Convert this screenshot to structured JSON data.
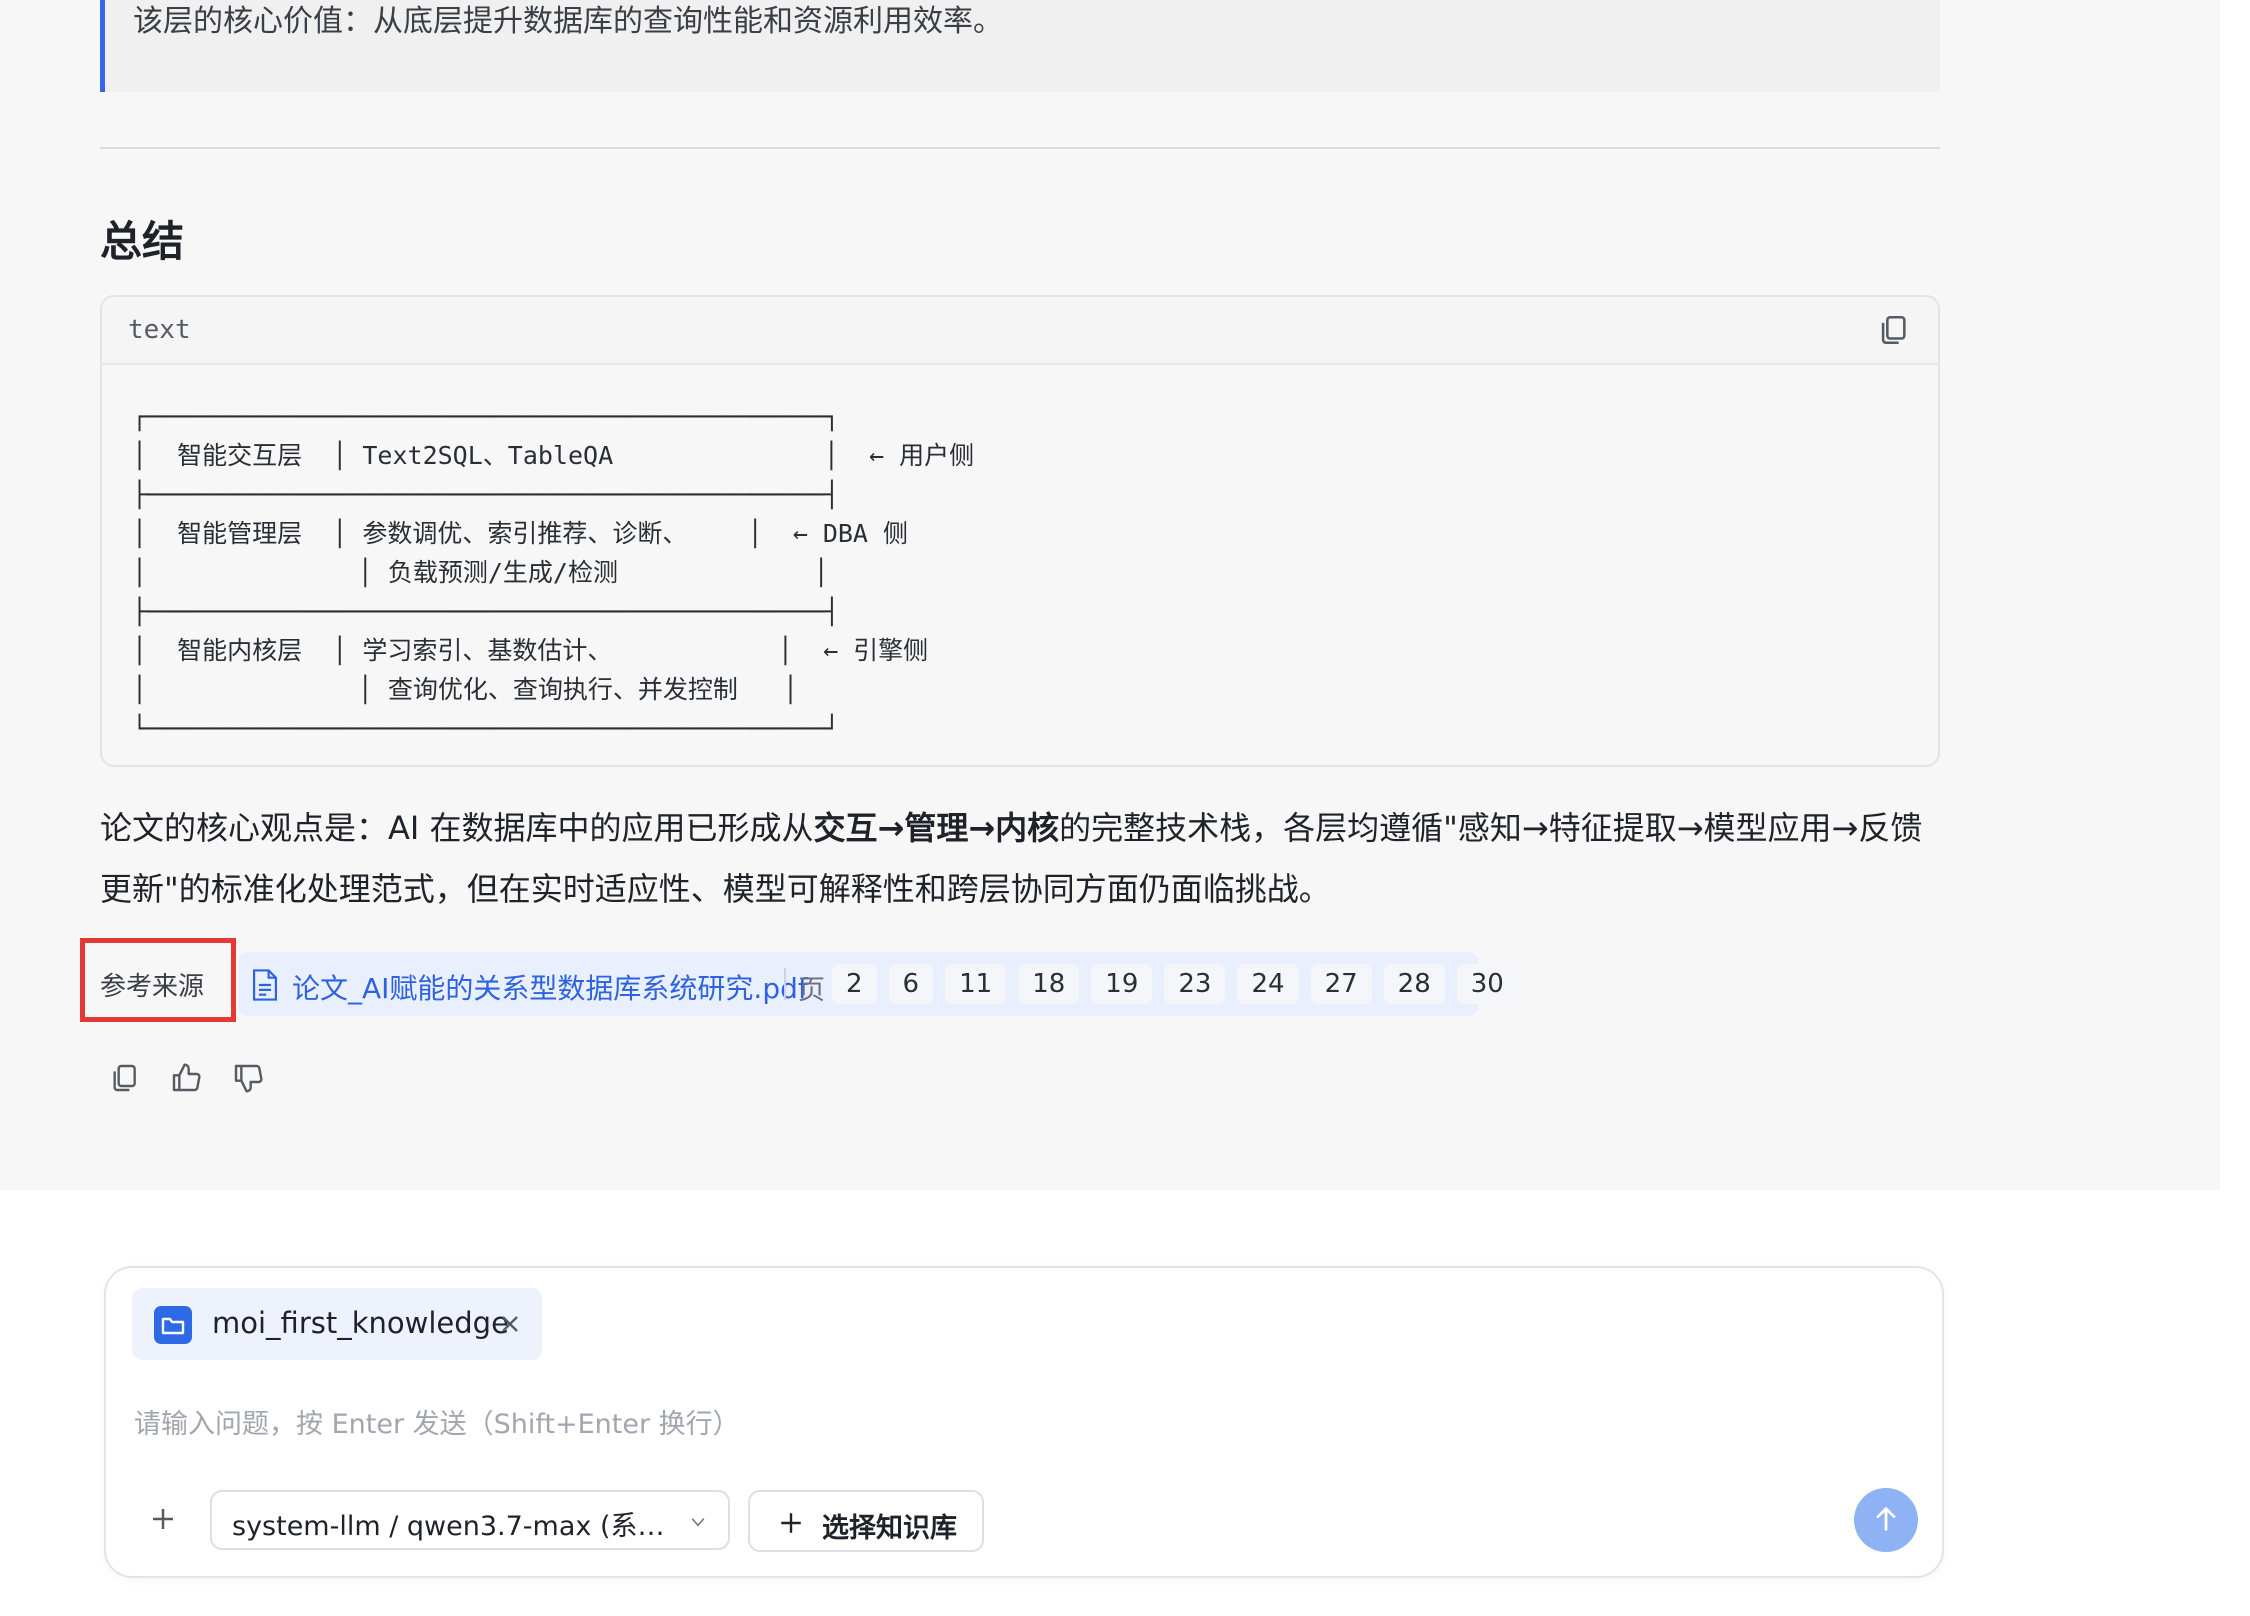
{
  "quote": {
    "text": "该层的核心价值：从底层提升数据库的查询性能和资源利用效率。"
  },
  "summary": {
    "title": "总结"
  },
  "code_block": {
    "language": "text",
    "content": "┌─────────────────────────────────────────────┐\n│  智能交互层  │ Text2SQL、TableQA              │  ← 用户侧\n├─────────────────────────────────────────────┤\n│  智能管理层  │ 参数调优、索引推荐、诊断、    │  ← DBA 侧\n│              │ 负载预测/生成/检测             │\n├─────────────────────────────────────────────┤\n│  智能内核层  │ 学习索引、基数估计、           │  ← 引擎侧\n│              │ 查询优化、查询执行、并发控制   │\n└─────────────────────────────────────────────┘"
  },
  "conclusion": {
    "prefix": "论文的核心观点是：AI 在数据库中的应用已形成从",
    "bold": "交互→管理→内核",
    "suffix": "的完整技术栈，各层均遵循\"感知→特征提取→模型应用→反馈更新\"的标准化处理范式，但在实时适应性、模型可解释性和跨层协同方面仍面临挑战。"
  },
  "references": {
    "label": "参考来源",
    "file_name": "论文_AI赋能的关系型数据库系统研究.pdf",
    "page_label": "页",
    "pages": [
      "2",
      "6",
      "11",
      "18",
      "19",
      "23",
      "24",
      "27",
      "28",
      "30"
    ]
  },
  "actions": {
    "icons": [
      "copy-icon",
      "thumbs-up-icon",
      "thumbs-down-icon"
    ]
  },
  "composer": {
    "knowledge_base": "moi_first_knowledge",
    "placeholder": "请输入问题，按 Enter 发送（Shift+Enter 换行）",
    "model": "system-llm / qwen3.7-max (系统...",
    "select_kb_label": "选择知识库"
  },
  "colors": {
    "accent": "#2f6ae6",
    "link": "#2d63e0",
    "highlight_box": "#e53935",
    "send_button": "#8eb2f4"
  }
}
